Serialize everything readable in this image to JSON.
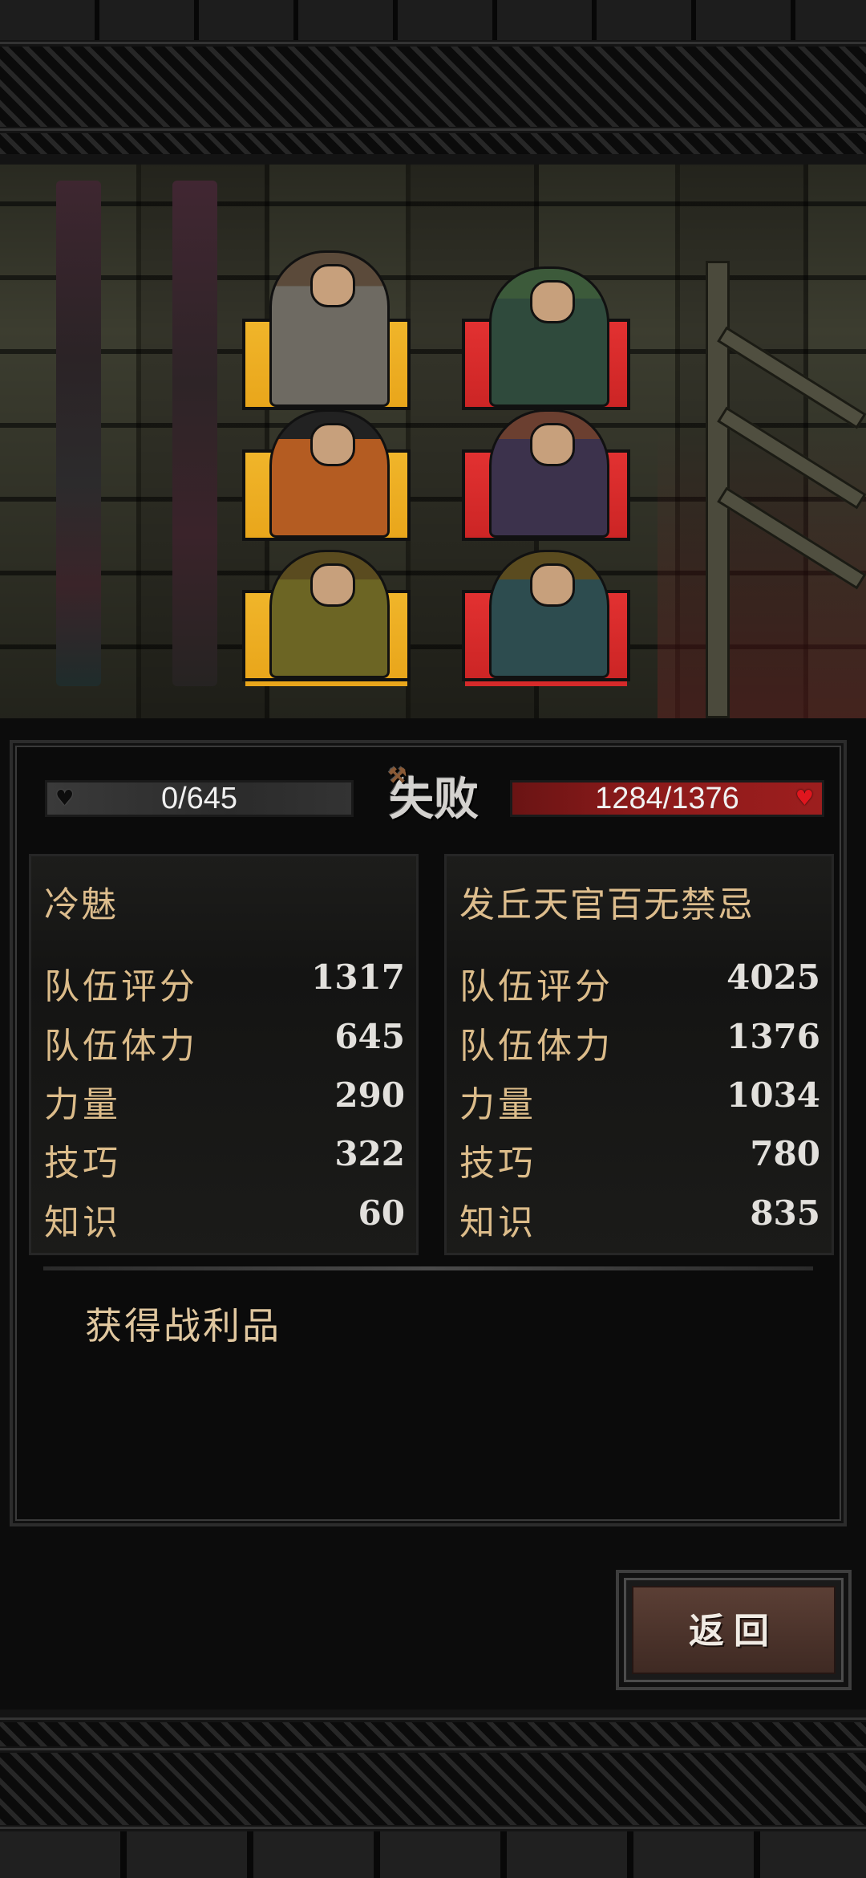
{
  "battle": {
    "result": "失败",
    "player_hp": "0/645",
    "enemy_hp": "1284/1376"
  },
  "player_team": {
    "name": "冷魅",
    "stats": [
      {
        "label": "队伍评分",
        "value": "1317"
      },
      {
        "label": "队伍体力",
        "value": "645"
      },
      {
        "label": "力量",
        "value": "290"
      },
      {
        "label": "技巧",
        "value": "322"
      },
      {
        "label": "知识",
        "value": "60"
      }
    ]
  },
  "enemy_team": {
    "name": "发丘天官百无禁忌",
    "stats": [
      {
        "label": "队伍评分",
        "value": "4025"
      },
      {
        "label": "队伍体力",
        "value": "1376"
      },
      {
        "label": "力量",
        "value": "1034"
      },
      {
        "label": "技巧",
        "value": "780"
      },
      {
        "label": "知识",
        "value": "835"
      }
    ]
  },
  "loot": {
    "label": "获得战利品"
  },
  "back_button": {
    "label": "返回"
  },
  "colors": {
    "player_frame": "#e9a61b",
    "enemy_frame": "#d62a2a",
    "enemy_hp_bar": "#8b1a1a",
    "stat_label": "#dcbc8a"
  },
  "icons": {
    "player_hp": "heart-icon",
    "enemy_hp": "heart-icon"
  }
}
